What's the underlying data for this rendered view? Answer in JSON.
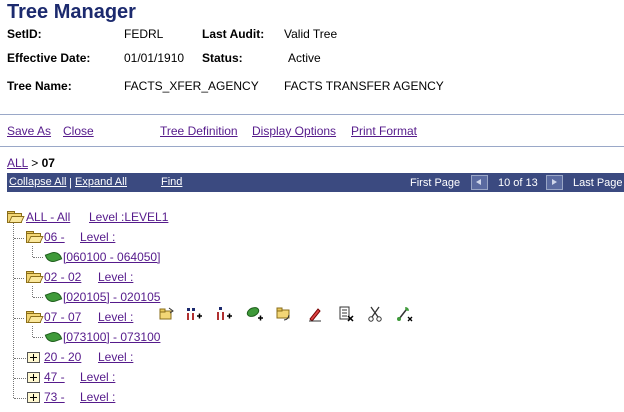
{
  "page": {
    "title": "Tree Manager"
  },
  "header": {
    "setid_label": "SetID:",
    "setid_value": "FEDRL",
    "last_audit_label": "Last Audit:",
    "last_audit_value": "Valid Tree",
    "effdate_label": "Effective Date:",
    "effdate_value": "01/01/1910",
    "status_label": "Status:",
    "status_value": "Active",
    "treename_label": "Tree Name:",
    "treename_value": "FACTS_XFER_AGENCY",
    "tree_desc": "FACTS TRANSFER AGENCY"
  },
  "toolbar": {
    "save_as": "Save As",
    "close": "Close",
    "tree_definition": "Tree Definition",
    "display_options": "Display Options",
    "print_format": "Print Format"
  },
  "breadcrumb": {
    "root": "ALL",
    "separator": ">",
    "current": "07"
  },
  "navbar": {
    "collapse_all": "Collapse All",
    "divider": "|",
    "expand_all": "Expand All",
    "find": "Find",
    "first_page": "First Page",
    "page_info": "10 of 13",
    "last_page": "Last Page"
  },
  "tree": {
    "root": {
      "label": "ALL - All",
      "level": "Level :LEVEL1"
    },
    "nodes": [
      {
        "label": "06 -",
        "level": "Level :",
        "detail": "[060100 - 064050]"
      },
      {
        "label": "02 - 02",
        "level": "Level :",
        "detail": "[020105] - 020105"
      },
      {
        "label": "07 - 07",
        "level": "Level :",
        "detail": "[073100] - 073100"
      },
      {
        "label": "20 - 20",
        "level": "Level :"
      },
      {
        "label": "47 -",
        "level": "Level :"
      },
      {
        "label": "73 -",
        "level": "Level :"
      }
    ]
  },
  "node_actions": [
    "open-node-icon",
    "insert-sibling-icon",
    "insert-child-icon",
    "insert-detail-icon",
    "move-node-icon",
    "edit-data-icon",
    "delete-node-icon",
    "cut-icon",
    "paste-icon"
  ],
  "colors": {
    "title": "#1c2a6e",
    "navbar": "#3b4a80",
    "link": "#551a8b",
    "leaf": "#3f9a3a",
    "folder": "#f3d675"
  }
}
